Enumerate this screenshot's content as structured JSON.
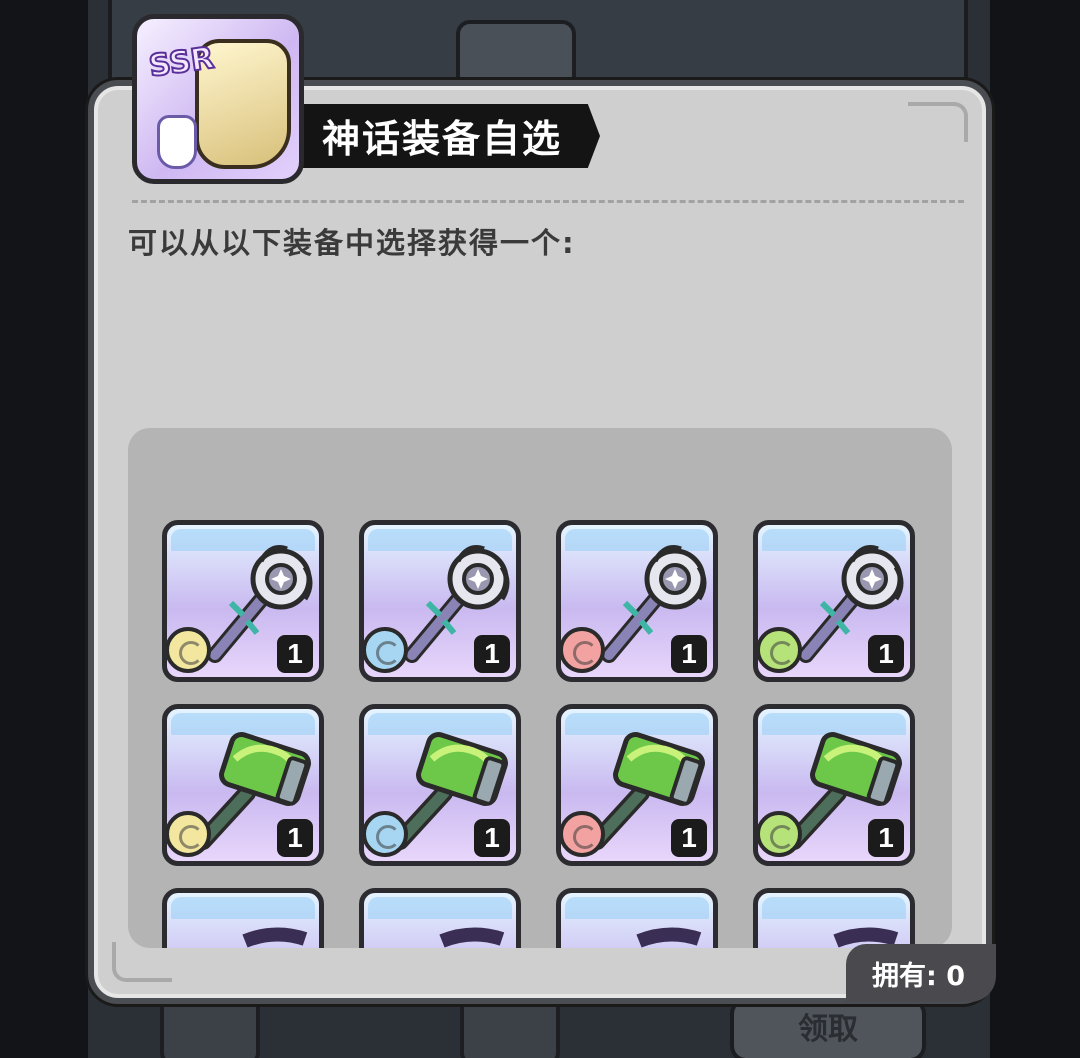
{
  "title": "神话装备自选",
  "title_icon": {
    "badge": "SSR",
    "icon": "armor-icon"
  },
  "description": "可以从以下装备中选择获得一个:",
  "owned": {
    "label": "拥有:",
    "value": "0"
  },
  "background_button": "领取",
  "colors": {
    "dialog_bg": "#cfcfcf",
    "panel_bg": "#b4b4b4",
    "title_bar": "#141414",
    "light": "#f3e7a0",
    "water": "#a6d6f2",
    "fire": "#f2a2a0",
    "wind": "#b6e27a"
  },
  "items": [
    {
      "weapon": "staff",
      "element": "light",
      "count": "1"
    },
    {
      "weapon": "staff",
      "element": "water",
      "count": "1"
    },
    {
      "weapon": "staff",
      "element": "fire",
      "count": "1"
    },
    {
      "weapon": "staff",
      "element": "wind",
      "count": "1"
    },
    {
      "weapon": "hammer",
      "element": "light",
      "count": "1"
    },
    {
      "weapon": "hammer",
      "element": "water",
      "count": "1"
    },
    {
      "weapon": "hammer",
      "element": "fire",
      "count": "1"
    },
    {
      "weapon": "hammer",
      "element": "wind",
      "count": "1"
    },
    {
      "weapon": "partial",
      "element": "",
      "count": ""
    },
    {
      "weapon": "partial",
      "element": "",
      "count": ""
    },
    {
      "weapon": "partial",
      "element": "",
      "count": ""
    },
    {
      "weapon": "partial",
      "element": "",
      "count": ""
    }
  ]
}
